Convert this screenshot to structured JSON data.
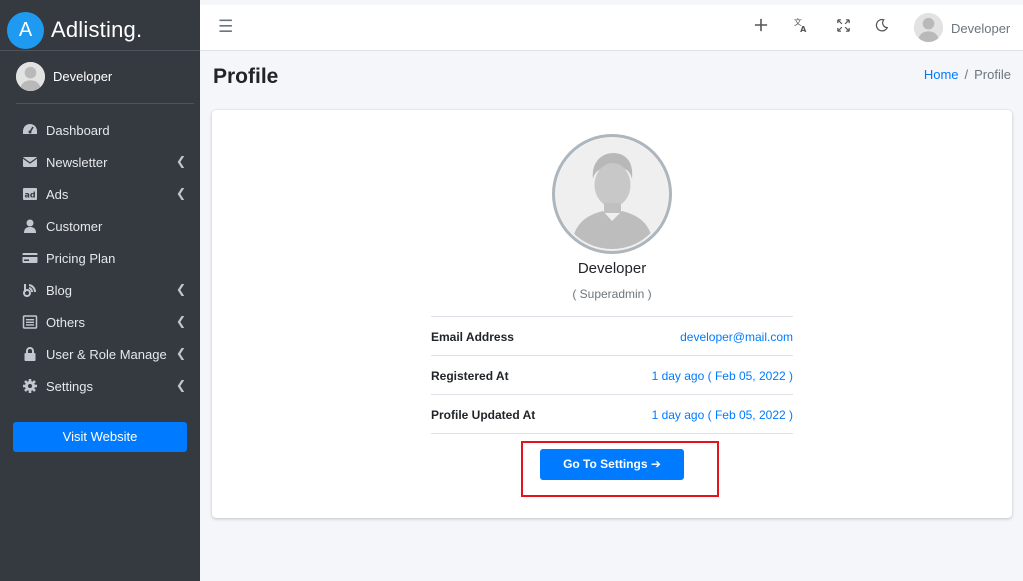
{
  "brand": {
    "logo_letter": "A",
    "name": "Adlisting."
  },
  "sidebar": {
    "user_name": "Developer",
    "items": [
      {
        "label": "Dashboard",
        "icon": "dashboard-icon",
        "has_submenu": false
      },
      {
        "label": "Newsletter",
        "icon": "envelope-icon",
        "has_submenu": true
      },
      {
        "label": "Ads",
        "icon": "ad-icon",
        "has_submenu": true
      },
      {
        "label": "Customer",
        "icon": "user-icon",
        "has_submenu": false
      },
      {
        "label": "Pricing Plan",
        "icon": "credit-card-icon",
        "has_submenu": false
      },
      {
        "label": "Blog",
        "icon": "blog-icon",
        "has_submenu": true
      },
      {
        "label": "Others",
        "icon": "list-icon",
        "has_submenu": true
      },
      {
        "label": "User & Role Manage",
        "icon": "lock-icon",
        "has_submenu": true
      },
      {
        "label": "Settings",
        "icon": "gear-icon",
        "has_submenu": true
      }
    ],
    "visit_website_label": "Visit Website"
  },
  "topnav": {
    "menu_icon": "hamburger-icon",
    "icons": [
      "plus-icon",
      "translate-icon",
      "fullscreen-icon",
      "moon-icon"
    ],
    "user_name": "Developer"
  },
  "content": {
    "page_title": "Profile",
    "breadcrumb": {
      "home": "Home",
      "separator": "/",
      "current": "Profile"
    }
  },
  "profile": {
    "name": "Developer",
    "role": "( Superadmin )",
    "rows": [
      {
        "label": "Email Address",
        "value": "developer@mail.com"
      },
      {
        "label": "Registered At",
        "value": "1 day ago ( Feb 05, 2022 )"
      },
      {
        "label": "Profile Updated At",
        "value": "1 day ago ( Feb 05, 2022 )"
      }
    ],
    "settings_button_label": "Go To Settings",
    "settings_button_arrow": "➔"
  },
  "colors": {
    "sidebar_bg": "#343a40",
    "primary": "#007bff",
    "highlight": "#e3121b",
    "brand_logo": "#1e9bf0"
  }
}
